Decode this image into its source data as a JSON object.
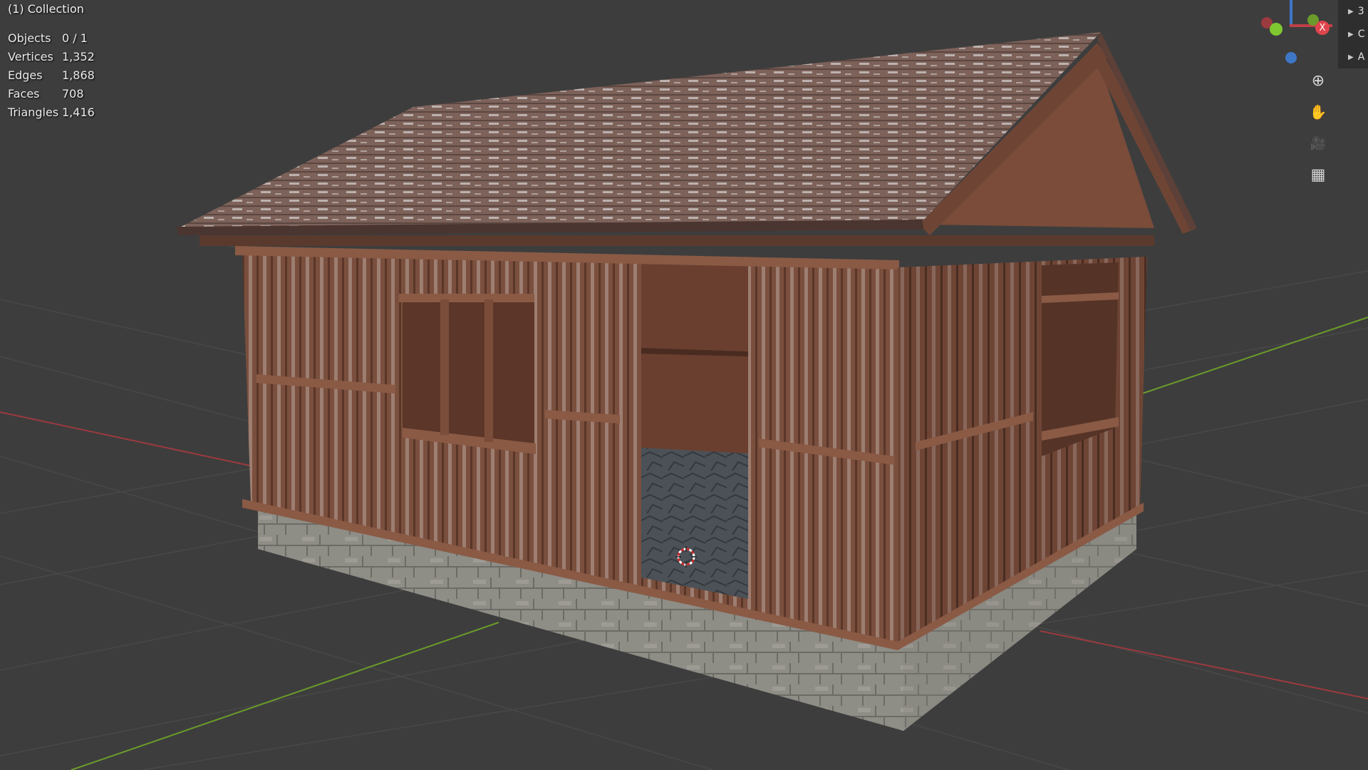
{
  "viewport": {
    "collection_label": "(1) Collection",
    "stats": [
      {
        "label": "Objects",
        "value": "0 / 1"
      },
      {
        "label": "Vertices",
        "value": "1,352"
      },
      {
        "label": "Edges",
        "value": "1,868"
      },
      {
        "label": "Faces",
        "value": "708"
      },
      {
        "label": "Triangles",
        "value": "1,416"
      }
    ]
  },
  "gizmo": {
    "x_label": "X",
    "x_color": "#e0444c",
    "y_color": "#80c832",
    "z_color": "#3f77c7"
  },
  "nav_tools": [
    {
      "name": "zoom-icon",
      "glyph": "⊕"
    },
    {
      "name": "hand-icon",
      "glyph": "✋"
    },
    {
      "name": "camera-icon",
      "glyph": "🎥"
    },
    {
      "name": "grid-icon",
      "glyph": "▦"
    }
  ],
  "outliner": {
    "items": [
      {
        "arrow": "▶",
        "label": "3"
      },
      {
        "arrow": "▶",
        "label": "C"
      },
      {
        "arrow": "▶",
        "label": "A"
      }
    ]
  }
}
